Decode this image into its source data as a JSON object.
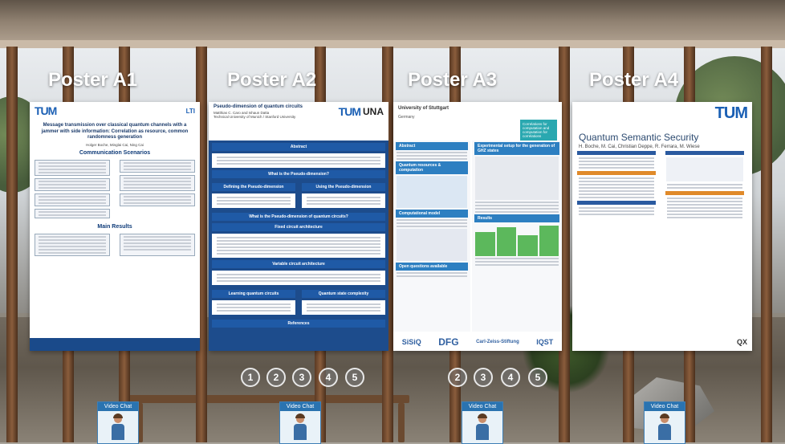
{
  "posters": [
    {
      "label": "Poster A1",
      "title": "Message transmission over classical quantum channels with a jammer with side information: Correlation as resource, common randomness generation",
      "authors": "Holger Boche, Minglai Cai, Ning Cai",
      "logo": "TUM",
      "logo2": "LTI",
      "sections": [
        "Communication Scenarios",
        "Main Results"
      ]
    },
    {
      "label": "Poster A2",
      "title": "Pseudo-dimension of quantum circuits",
      "authors": "Matthias C. Caro and Ishaun Datta",
      "affil": "Technical University of Munich / Stanford University",
      "logo": "TUM",
      "logo2": "UNA",
      "sections": [
        "Abstract",
        "What is the Pseudo-dimension?",
        "Defining the Pseudo-dimension",
        "Using the Pseudo-dimension",
        "What is the Pseudo-dimension of quantum circuits?",
        "Fixed circuit architecture",
        "Variable circuit architecture",
        "Learning quantum circuits",
        "Quantum state complexity",
        "References"
      ]
    },
    {
      "label": "Poster A3",
      "university": "University of Stuttgart",
      "country": "Germany",
      "side_text": "Correlations for computation and computation for correlations",
      "sections": [
        "Abstract",
        "Quantum resources & computation",
        "Experimental setup for the generation of GHZ states",
        "Computational model",
        "Results",
        "Open questions available"
      ],
      "logos": [
        "SiSiQ",
        "DFG",
        "Carl-Zeiss-Stiftung",
        "IQST"
      ]
    },
    {
      "label": "Poster A4",
      "title": "Quantum Semantic Security",
      "authors": "H. Boche, M. Cai, Christian Deppe, R. Ferrara, M. Wiese",
      "logo": "TUM",
      "logo2": "QX"
    }
  ],
  "circle_buttons_a": [
    "1",
    "2",
    "3",
    "4",
    "5"
  ],
  "circle_buttons_b": [
    "2",
    "3",
    "4",
    "5"
  ],
  "video_chat_label": "Video Chat"
}
